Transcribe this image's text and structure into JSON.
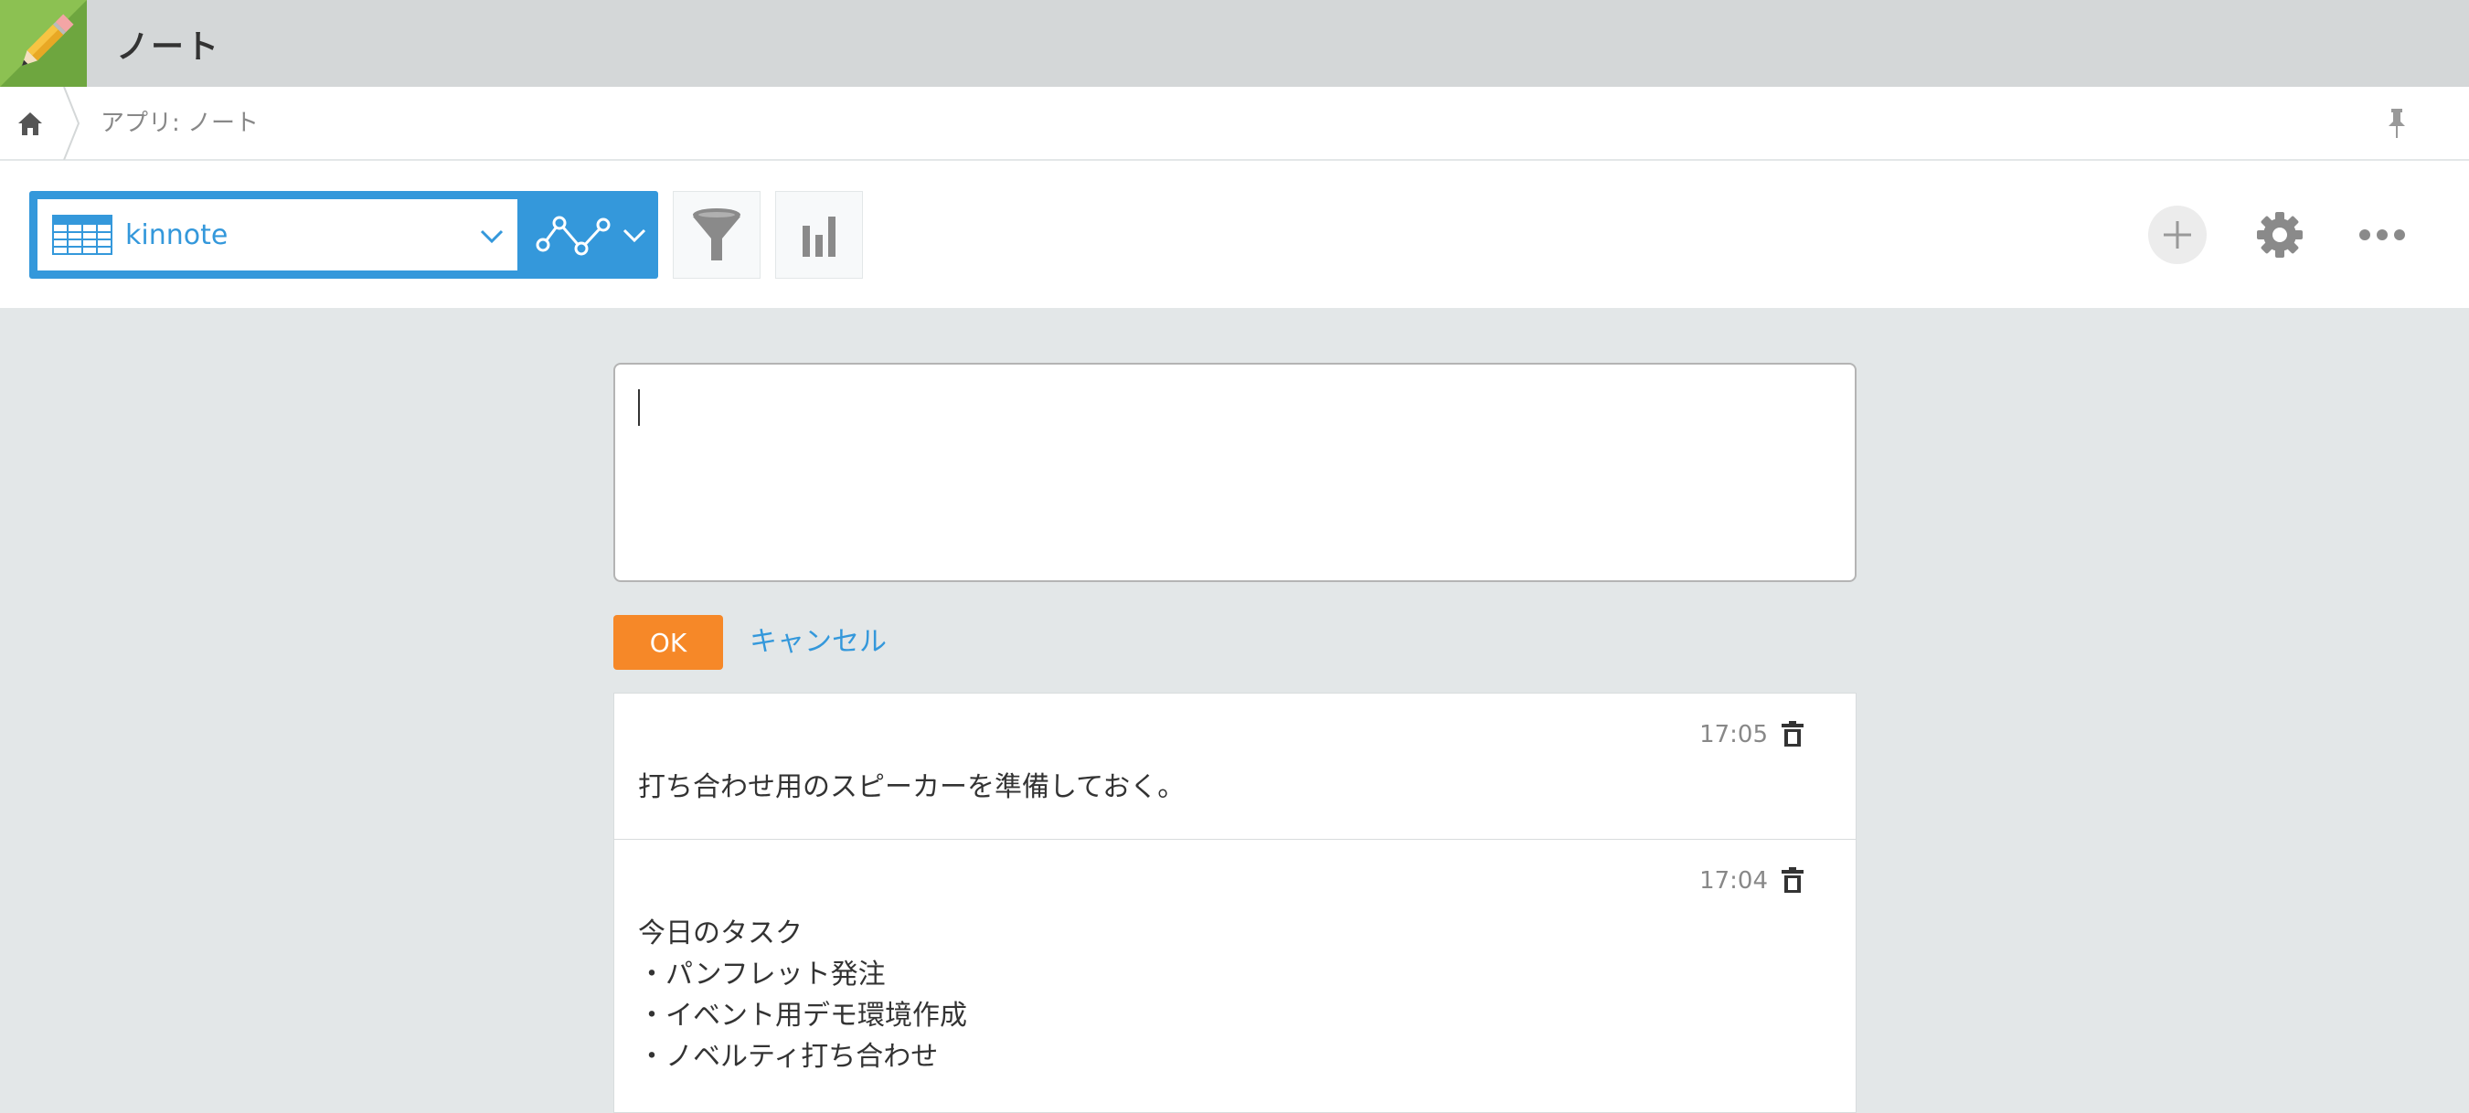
{
  "header": {
    "app_title": "ノート"
  },
  "breadcrumb": {
    "current": "アプリ: ノート"
  },
  "toolbar": {
    "view_name": "kinnote",
    "icons": [
      "table-icon",
      "chevron-down-icon",
      "graph-icon",
      "filter-icon",
      "bar-chart-icon",
      "plus-icon",
      "gear-icon",
      "more-icon"
    ]
  },
  "editor": {
    "value": ""
  },
  "actions": {
    "ok_label": "OK",
    "cancel_label": "キャンセル"
  },
  "notes": [
    {
      "time": "17:05",
      "lines": [
        "打ち合わせ用のスピーカーを準備しておく。"
      ]
    },
    {
      "time": "17:04",
      "lines": [
        "今日のタスク",
        "・パンフレット発注",
        "・イベント用デモ環境作成",
        "・ノベルティ打ち合わせ"
      ]
    }
  ],
  "colors": {
    "accent": "#3498db",
    "ok": "#f68828",
    "app_icon": "#8cc152"
  }
}
